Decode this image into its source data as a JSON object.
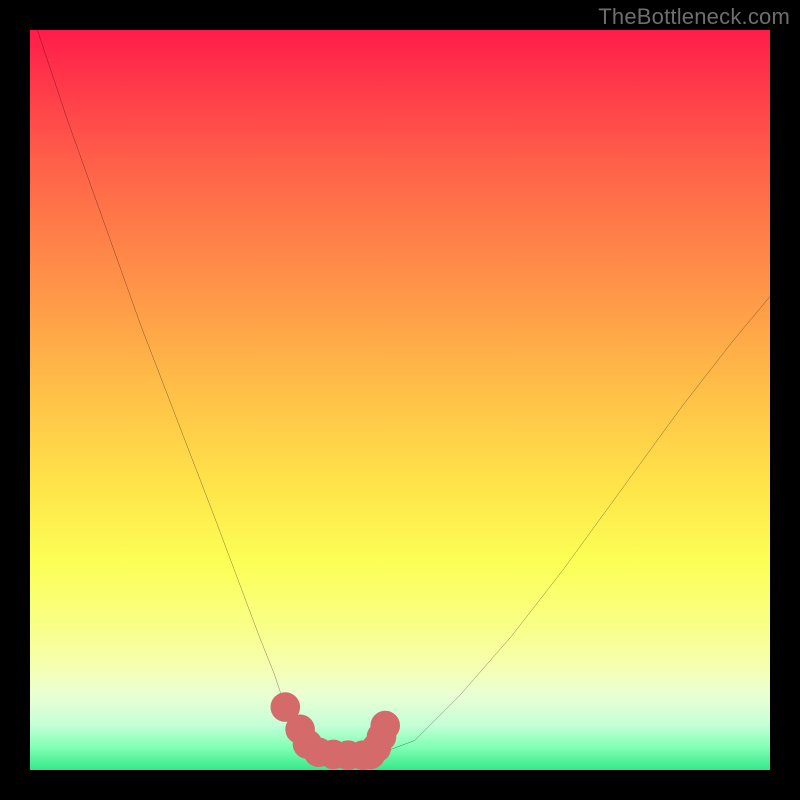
{
  "watermark": "TheBottleneck.com",
  "chart_data": {
    "type": "line",
    "title": "",
    "xlabel": "",
    "ylabel": "",
    "xlim": [
      0,
      100
    ],
    "ylim": [
      0,
      100
    ],
    "grid": false,
    "series": [
      {
        "name": "curve",
        "color": "#000000",
        "x": [
          1,
          5,
          10,
          15,
          20,
          25,
          28,
          31,
          33,
          34,
          35,
          36,
          37,
          38,
          39,
          41,
          43,
          45,
          46,
          48,
          52,
          58,
          65,
          72,
          80,
          88,
          95,
          100
        ],
        "values": [
          100,
          88,
          74,
          60,
          47,
          34,
          26,
          18,
          13,
          10,
          8,
          6,
          4,
          3,
          2.4,
          2.1,
          2.0,
          2.0,
          2.1,
          2.5,
          4,
          10,
          18,
          27,
          38,
          49,
          58,
          64
        ]
      }
    ],
    "markers": {
      "name": "bottom-dots",
      "color": "#d46a6a",
      "radius": 2.0,
      "points": [
        {
          "x": 34.5,
          "y": 8.5
        },
        {
          "x": 36.5,
          "y": 5.5
        },
        {
          "x": 37.5,
          "y": 3.5
        },
        {
          "x": 39.0,
          "y": 2.4
        },
        {
          "x": 41.0,
          "y": 2.1
        },
        {
          "x": 43.0,
          "y": 2.0
        },
        {
          "x": 45.0,
          "y": 2.0
        },
        {
          "x": 46.0,
          "y": 2.1
        },
        {
          "x": 46.8,
          "y": 3.0
        },
        {
          "x": 47.5,
          "y": 4.5
        },
        {
          "x": 48.0,
          "y": 6.0
        }
      ]
    }
  }
}
